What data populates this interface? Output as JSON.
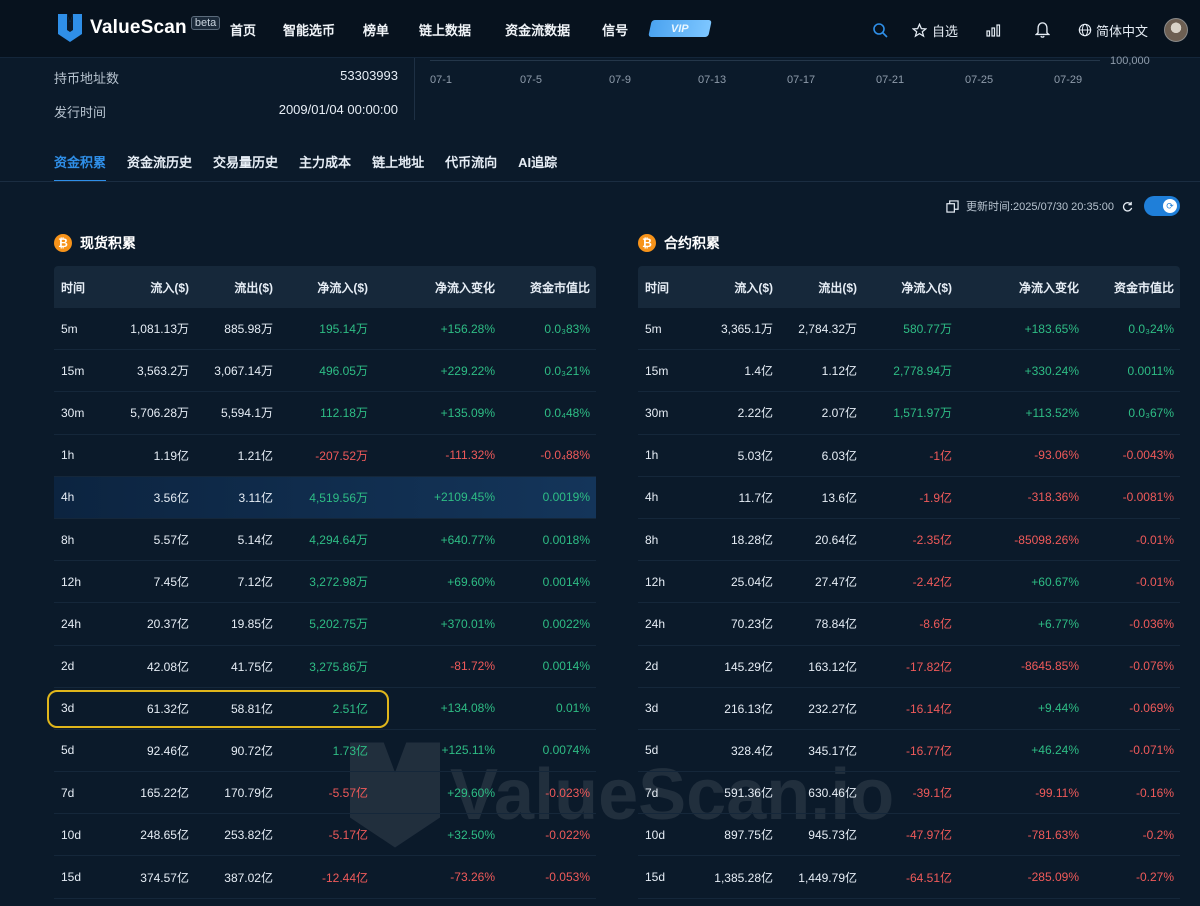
{
  "nav": {
    "brand": "ValueScan",
    "beta": "beta",
    "menu": [
      "首页",
      "智能选币",
      "榜单",
      "链上数据",
      "资金流数据",
      "信号"
    ],
    "vip": "VIP",
    "favorites": "自选",
    "language": "简体中文"
  },
  "info": [
    {
      "label": "持币地址数",
      "value": "53303993"
    },
    {
      "label": "发行时间",
      "value": "2009/01/04 00:00:00"
    }
  ],
  "chart_axis": {
    "x_ticks": [
      "07-1",
      "07-5",
      "07-9",
      "07-13",
      "07-17",
      "07-21",
      "07-25",
      "07-29"
    ],
    "y_tick": "100,000"
  },
  "tabs": [
    "资金积累",
    "资金流历史",
    "交易量历史",
    "主力成本",
    "链上地址",
    "代币流向",
    "AI追踪"
  ],
  "active_tab": 0,
  "update_time": "更新时间:2025/07/30 20:35:00",
  "colors": {
    "accent": "#2f8fe8",
    "positive": "#2ebd85",
    "negative": "#f05a5a",
    "highlight_box": "#e0b61b"
  },
  "headers": [
    "时间",
    "流入($)",
    "流出($)",
    "净流入($)",
    "净流入变化",
    "资金市值比"
  ],
  "spot": {
    "title": "现货积累",
    "rows": [
      [
        "5m",
        "1,081.13万",
        "885.98万",
        "195.14万",
        "+156.28%",
        "0.0₃83%"
      ],
      [
        "15m",
        "3,563.2万",
        "3,067.14万",
        "496.05万",
        "+229.22%",
        "0.0₃21%"
      ],
      [
        "30m",
        "5,706.28万",
        "5,594.1万",
        "112.18万",
        "+135.09%",
        "0.0₄48%"
      ],
      [
        "1h",
        "1.19亿",
        "1.21亿",
        "-207.52万",
        "-111.32%",
        "-0.0₄88%"
      ],
      [
        "4h",
        "3.56亿",
        "3.11亿",
        "4,519.56万",
        "+2109.45%",
        "0.0019%"
      ],
      [
        "8h",
        "5.57亿",
        "5.14亿",
        "4,294.64万",
        "+640.77%",
        "0.0018%"
      ],
      [
        "12h",
        "7.45亿",
        "7.12亿",
        "3,272.98万",
        "+69.60%",
        "0.0014%"
      ],
      [
        "24h",
        "20.37亿",
        "19.85亿",
        "5,202.75万",
        "+370.01%",
        "0.0022%"
      ],
      [
        "2d",
        "42.08亿",
        "41.75亿",
        "3,275.86万",
        "-81.72%",
        "0.0014%"
      ],
      [
        "3d",
        "61.32亿",
        "58.81亿",
        "2.51亿",
        "+134.08%",
        "0.01%"
      ],
      [
        "5d",
        "92.46亿",
        "90.72亿",
        "1.73亿",
        "+125.11%",
        "0.0074%"
      ],
      [
        "7d",
        "165.22亿",
        "170.79亿",
        "-5.57亿",
        "+29.60%",
        "-0.023%"
      ],
      [
        "10d",
        "248.65亿",
        "253.82亿",
        "-5.17亿",
        "+32.50%",
        "-0.022%"
      ],
      [
        "15d",
        "374.57亿",
        "387.02亿",
        "-12.44亿",
        "-73.26%",
        "-0.053%"
      ]
    ]
  },
  "futures": {
    "title": "合约积累",
    "rows": [
      [
        "5m",
        "3,365.1万",
        "2,784.32万",
        "580.77万",
        "+183.65%",
        "0.0₃24%"
      ],
      [
        "15m",
        "1.4亿",
        "1.12亿",
        "2,778.94万",
        "+330.24%",
        "0.0011%"
      ],
      [
        "30m",
        "2.22亿",
        "2.07亿",
        "1,571.97万",
        "+113.52%",
        "0.0₃67%"
      ],
      [
        "1h",
        "5.03亿",
        "6.03亿",
        "-1亿",
        "-93.06%",
        "-0.0043%"
      ],
      [
        "4h",
        "11.7亿",
        "13.6亿",
        "-1.9亿",
        "-318.36%",
        "-0.0081%"
      ],
      [
        "8h",
        "18.28亿",
        "20.64亿",
        "-2.35亿",
        "-85098.26%",
        "-0.01%"
      ],
      [
        "12h",
        "25.04亿",
        "27.47亿",
        "-2.42亿",
        "+60.67%",
        "-0.01%"
      ],
      [
        "24h",
        "70.23亿",
        "78.84亿",
        "-8.6亿",
        "+6.77%",
        "-0.036%"
      ],
      [
        "2d",
        "145.29亿",
        "163.12亿",
        "-17.82亿",
        "-8645.85%",
        "-0.076%"
      ],
      [
        "3d",
        "216.13亿",
        "232.27亿",
        "-16.14亿",
        "+9.44%",
        "-0.069%"
      ],
      [
        "5d",
        "328.4亿",
        "345.17亿",
        "-16.77亿",
        "+46.24%",
        "-0.071%"
      ],
      [
        "7d",
        "591.36亿",
        "630.46亿",
        "-39.1亿",
        "-99.11%",
        "-0.16%"
      ],
      [
        "10d",
        "897.75亿",
        "945.73亿",
        "-47.97亿",
        "-781.63%",
        "-0.2%"
      ],
      [
        "15d",
        "1,385.28亿",
        "1,449.79亿",
        "-64.51亿",
        "-285.09%",
        "-0.27%"
      ]
    ]
  },
  "watermark": "ValueScan.io"
}
